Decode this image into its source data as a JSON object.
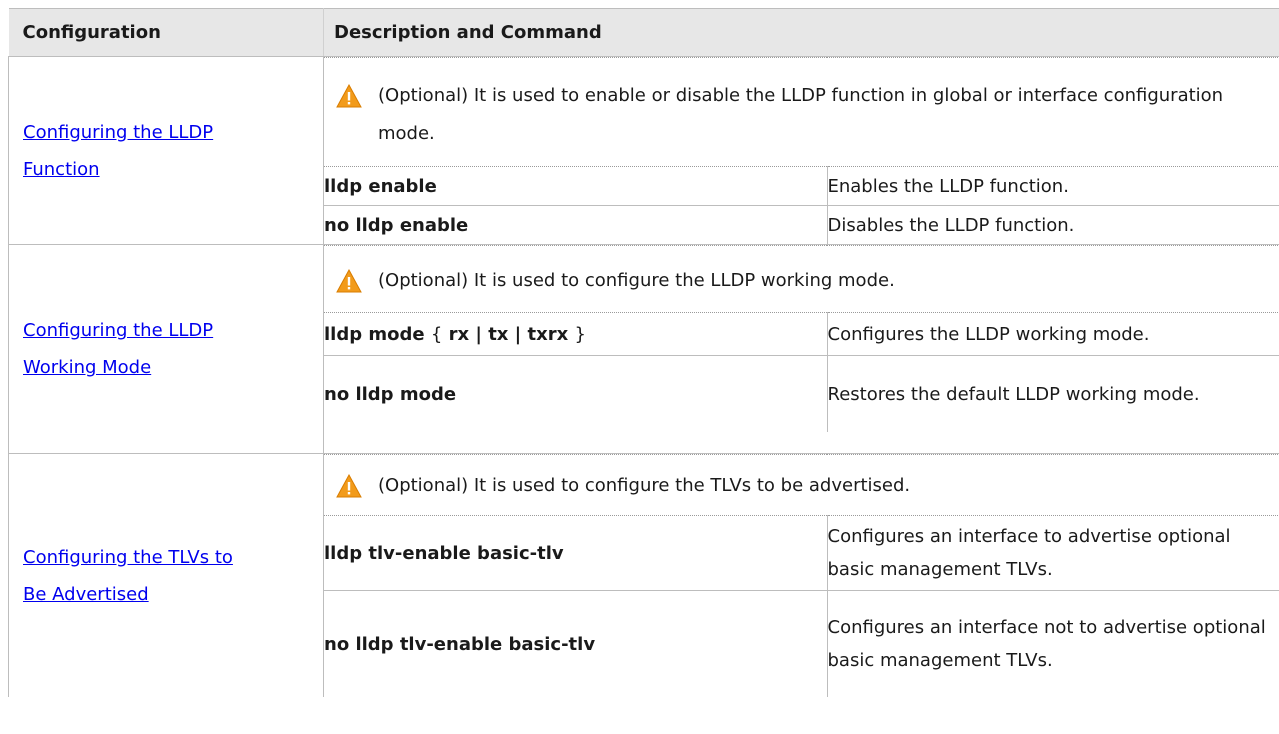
{
  "header": {
    "col_config": "Configuration",
    "col_desc": "Description and Command"
  },
  "sections": [
    {
      "config_line1": "Configuring the LLDP",
      "config_line2": "Function",
      "note": "(Optional) It is used to enable or disable the LLDP function in global or interface configuration mode.",
      "commands": [
        {
          "cmd": "lldp enable",
          "desc": "Enables the LLDP function."
        },
        {
          "cmd": "no lldp enable",
          "desc": "Disables the LLDP function."
        }
      ]
    },
    {
      "config_line1": "Configuring the LLDP",
      "config_line2": "Working Mode",
      "note": "(Optional) It is used to configure the LLDP working mode.",
      "commands": [
        {
          "cmd_prefix": "lldp mode",
          "brace_open": "{",
          "cmd_args": "rx | tx | txrx",
          "brace_close": "}",
          "desc": "Configures the LLDP working mode."
        },
        {
          "cmd": "no lldp mode",
          "desc": "Restores the default LLDP working mode."
        }
      ]
    },
    {
      "config_line1": "Configuring the TLVs to",
      "config_line2": "Be Advertised",
      "note": "(Optional) It is used to configure the TLVs to be advertised.",
      "commands": [
        {
          "cmd": "lldp tlv-enable basic-tlv",
          "desc": "Configures an interface to advertise optional basic management TLVs."
        },
        {
          "cmd": "no lldp tlv-enable basic-tlv",
          "desc": "Configures an interface not to advertise optional basic management TLVs."
        }
      ]
    }
  ],
  "icons": {
    "warning": "warning-icon",
    "warning_color": "#f29b1b"
  }
}
